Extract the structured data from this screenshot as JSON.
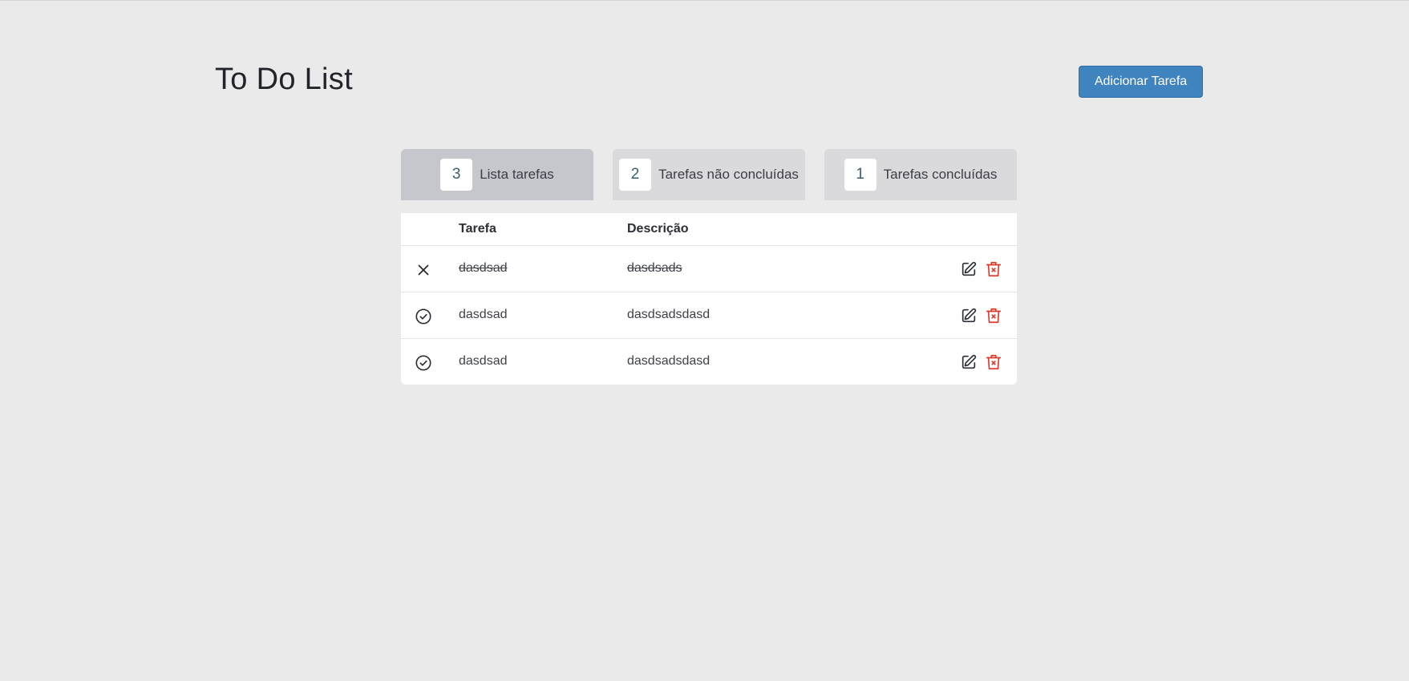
{
  "header": {
    "title": "To Do List",
    "add_button_label": "Adicionar Tarefa"
  },
  "tabs": [
    {
      "count": "3",
      "label": "Lista tarefas",
      "active": true
    },
    {
      "count": "2",
      "label": "Tarefas não concluídas",
      "active": false
    },
    {
      "count": "1",
      "label": "Tarefas concluídas",
      "active": false
    }
  ],
  "table": {
    "columns": {
      "task": "Tarefa",
      "description": "Descrição"
    },
    "rows": [
      {
        "task": "dasdsad",
        "description": "dasdsads",
        "done": true,
        "status_icon": "x-icon"
      },
      {
        "task": "dasdsad",
        "description": "dasdsadsdasd",
        "done": false,
        "status_icon": "check-circle-icon"
      },
      {
        "task": "dasdsad",
        "description": "dasdsadsdasd",
        "done": false,
        "status_icon": "check-circle-icon"
      }
    ]
  },
  "colors": {
    "accent": "#3f83bf",
    "delete": "#e0392b",
    "background": "#eaeaeb"
  }
}
